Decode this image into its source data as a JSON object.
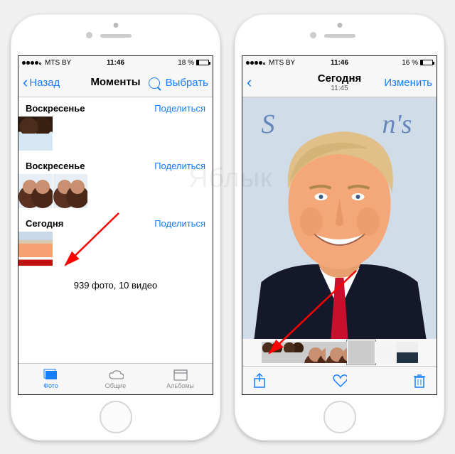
{
  "watermark": "Яблык",
  "left_phone": {
    "status": {
      "carrier": "MTS BY",
      "time": "11:46",
      "battery_pct": "18 %",
      "battery_fill": 18
    },
    "nav": {
      "back": "Назад",
      "title": "Моменты",
      "select": "Выбрать"
    },
    "sections": [
      {
        "name": "Воскресенье",
        "share": "Поделиться",
        "thumbs": [
          "horses"
        ]
      },
      {
        "name": "Воскресенье",
        "share": "Поделиться",
        "thumbs": [
          "girls",
          "girls"
        ]
      },
      {
        "name": "Сегодня",
        "share": "Поделиться",
        "thumbs": [
          "trump"
        ]
      }
    ],
    "counter": "939 фото, 10 видео",
    "tabs": [
      {
        "label": "Фото",
        "active": true
      },
      {
        "label": "Общие",
        "active": false
      },
      {
        "label": "Альбомы",
        "active": false
      }
    ]
  },
  "right_phone": {
    "status": {
      "carrier": "MTS BY",
      "time": "11:46",
      "battery_pct": "16 %",
      "battery_fill": 16
    },
    "nav": {
      "title": "Сегодня",
      "subtitle": "11:45",
      "edit": "Изменить"
    },
    "filmstrip_count": 7,
    "toolbar": {
      "share": "share-icon",
      "like": "heart-icon",
      "delete": "trash-icon"
    }
  }
}
